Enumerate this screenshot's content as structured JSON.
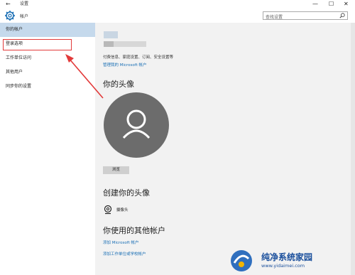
{
  "titlebar": {
    "back": "←",
    "title": "设置",
    "min": "—",
    "max": "☐",
    "close": "✕"
  },
  "header": {
    "title": "帐户",
    "search_placeholder": "查找设置"
  },
  "sidebar": {
    "items": [
      {
        "label": "你的帐户"
      },
      {
        "label": "登录选项"
      },
      {
        "label": "工作单位访问"
      },
      {
        "label": "其他用户"
      },
      {
        "label": "同步你的设置"
      }
    ]
  },
  "main": {
    "info_text": "付费信息、家庭设置、订阅、安全设置等",
    "manage_link": "管理我的 Microsoft 帐户",
    "avatar_heading": "你的头像",
    "browse_button": "浏览",
    "create_heading": "创建你的头像",
    "camera_label": "摄像头",
    "other_heading": "你使用的其他帐户",
    "add_ms_link": "添加 Microsoft 帐户",
    "add_work_link": "添加工作单位或学校帐户"
  },
  "watermark": {
    "text": "纯净系统家园",
    "url": "www.yidaimei.com"
  },
  "colors": {
    "accent": "#1a6fb5",
    "active_bg": "#c5d9ec",
    "highlight": "#e23a3a"
  }
}
